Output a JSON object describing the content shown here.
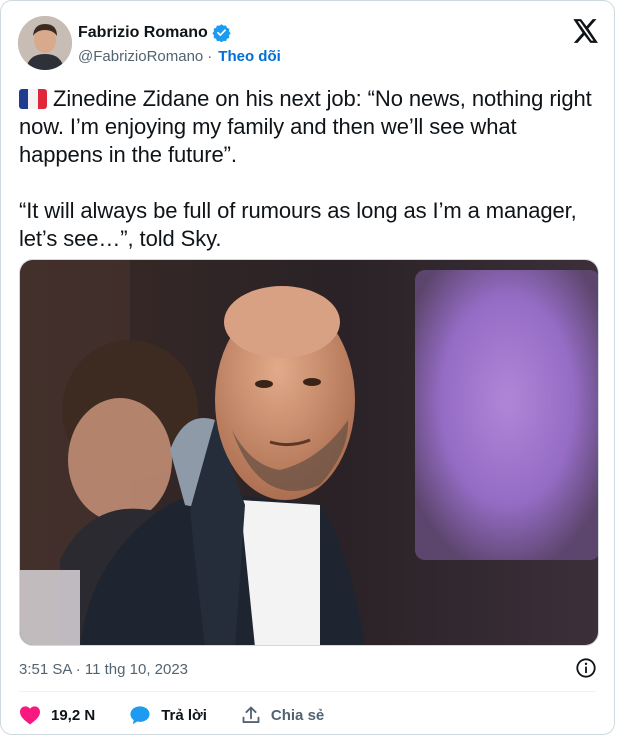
{
  "author": {
    "name": "Fabrizio Romano",
    "handle": "@FabrizioRomano",
    "separator": "·",
    "follow_label": "Theo dõi",
    "verified_color": "#1d9bf0"
  },
  "tweet": {
    "flag": "france-flag",
    "text": "Zinedine Zidane on his next job: “No news, nothing right now. I’m enjoying my family and then we’ll see what happens in the future”.\n\n“It will always be full of rumours as long as I’m a manager, let’s see…”, told Sky.",
    "timestamp": "3:51 SA · 11 thg 10, 2023"
  },
  "actions": {
    "likes": "19,2 N",
    "reply_label": "Trả lời",
    "share_label": "Chia sẻ"
  },
  "colors": {
    "like": "#f91880",
    "reply": "#1d9bf0",
    "link": "#006fd6"
  }
}
